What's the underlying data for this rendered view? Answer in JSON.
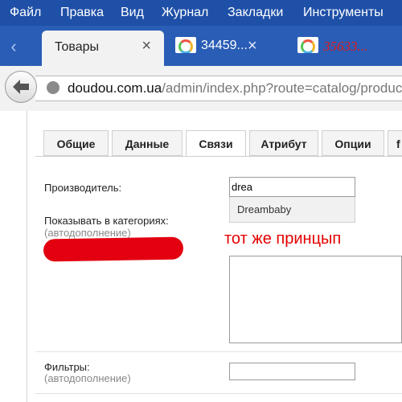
{
  "menubar": {
    "items": [
      "Файл",
      "Правка",
      "Вид",
      "Журнал",
      "Закладки",
      "Инструменты"
    ]
  },
  "browser_tabs": [
    {
      "label": "Товары",
      "active": true,
      "close": "×"
    },
    {
      "label": "34459...",
      "active": false,
      "close": "×"
    },
    {
      "label": "35633...",
      "active": false
    }
  ],
  "urlbar": {
    "host": "doudou.com.ua",
    "path": "/admin/index.php?route=catalog/produc"
  },
  "page_tabs": [
    "Общие",
    "Данные",
    "Связи",
    "Атрибут",
    "Опции",
    "f"
  ],
  "active_page_tab": "Связи",
  "form": {
    "manufacturer_label": "Производитель:",
    "manufacturer_value": "drea",
    "autocomplete_option": "Dreambaby",
    "categories_label": "Показывать в категориях:",
    "categories_hint": "(автодополнение)",
    "filters_label": "Фильтры:",
    "filters_hint": "(автодополнение)"
  },
  "annotation": "тот же принцып",
  "colors": {
    "menubar": "#1f50a8",
    "tabstrip": "#2a5db6",
    "annotation_red": "#e30000"
  }
}
